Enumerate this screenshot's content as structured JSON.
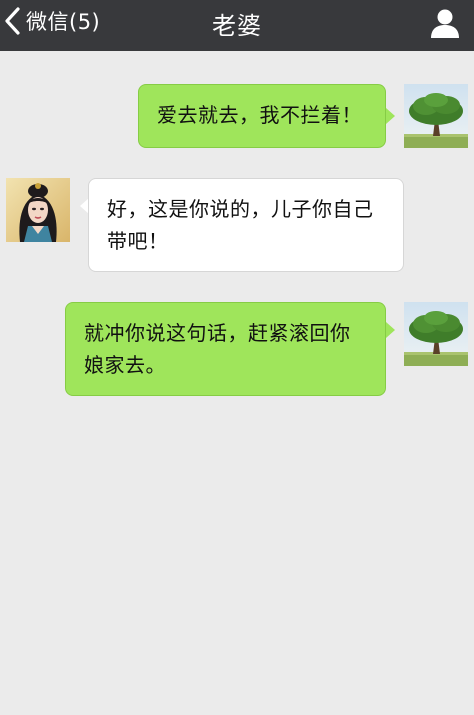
{
  "nav": {
    "back_label": "微信(5)",
    "title": "老婆",
    "back_icon": "chevron-left-icon",
    "profile_icon": "person-icon"
  },
  "colors": {
    "nav_background": "#38393c",
    "chat_background": "#ebebeb",
    "sent_bubble": "#9fe55b",
    "received_bubble": "#ffffff"
  },
  "messages": [
    {
      "sender": "me",
      "text": "爱去就去，我不拦着！"
    },
    {
      "sender": "contact",
      "text": "好，这是你说的，儿子你自己带吧！"
    },
    {
      "sender": "me",
      "text": "就冲你说这句话，赶紧滚回你娘家去。"
    }
  ]
}
